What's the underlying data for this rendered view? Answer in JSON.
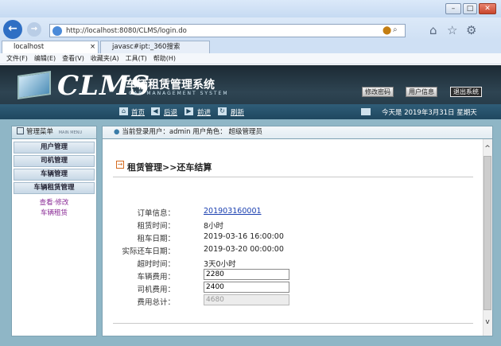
{
  "browser": {
    "url": "http://localhost:8080/CLMS/login.do",
    "tabs": [
      {
        "label": "localhost",
        "close": "×"
      },
      {
        "label": "javasc#ipt:_360搜索"
      }
    ],
    "menu": [
      "文件(F)",
      "编辑(E)",
      "查看(V)",
      "收藏夹(A)",
      "工具(T)",
      "帮助(H)"
    ]
  },
  "header": {
    "logo": "CLMS",
    "system_name": "车辆租赁管理系统",
    "english": "CAR MANAGEMENT SYSTEM",
    "buttons": {
      "password": "修改密码",
      "user_info": "用户信息",
      "logout": "退出系统"
    },
    "nav": {
      "home": "首页",
      "back": "后退",
      "forward": "前进",
      "refresh": "刷新"
    },
    "today": "今天是 2019年3月31日 星期天"
  },
  "sidebar": {
    "title": "管理菜单",
    "title_en": "MAIN MENU",
    "groups": [
      "用户管理",
      "司机管理",
      "车辆管理",
      "车辆租赁管理"
    ],
    "links": [
      "查看·修改",
      "车辆租赁"
    ]
  },
  "infobar": {
    "text": "当前登录用户：admin  用户角色： 超级管理员"
  },
  "panel": {
    "title": "租赁管理>>还车结算",
    "fields": {
      "order_label": "订单信息：",
      "order_value": "201903160001",
      "rent_time_label": "租赁时间：",
      "rent_time_value": "8小时",
      "rent_date_label": "租车日期：",
      "rent_date_value": "2019-03-16 16:00:00",
      "return_date_label": "实际还车日期：",
      "return_date_value": "2019-03-20 00:00:00",
      "overtime_label": "超时时间：",
      "overtime_value": "3天0小时",
      "car_fee_label": "车辆费用：",
      "car_fee_value": "2280",
      "driver_fee_label": "司机费用：",
      "driver_fee_value": "2400",
      "total_label": "费用总计：",
      "total_value": "4680"
    }
  },
  "colors": {
    "header_dark": "#1f3441",
    "nav_band": "#1f475f",
    "main_bg": "#8fb6c6",
    "link": "#1a3fb0",
    "sidebar_link": "#8a2b96"
  }
}
